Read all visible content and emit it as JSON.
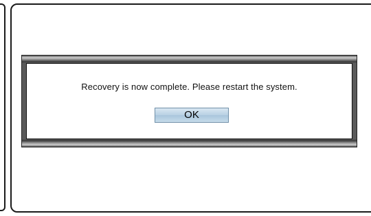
{
  "dialog": {
    "message": "Recovery is now complete. Please restart the system.",
    "ok_label": "OK"
  }
}
